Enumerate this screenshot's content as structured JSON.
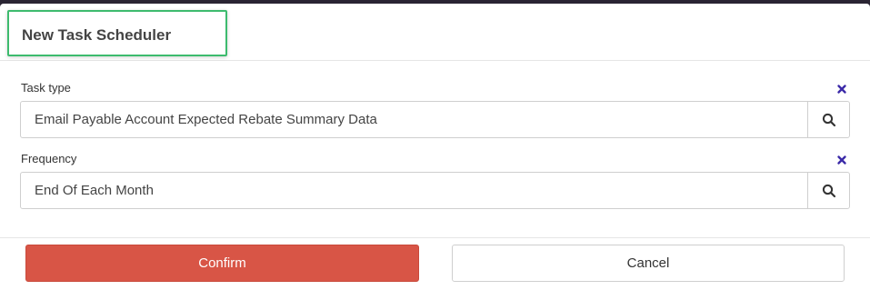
{
  "dialog": {
    "title": "New Task Scheduler"
  },
  "fields": {
    "task_type": {
      "label": "Task type",
      "value": "Email Payable Account Expected Rebate Summary Data",
      "clear_icon": "close-x-icon",
      "search_icon": "search-icon"
    },
    "frequency": {
      "label": "Frequency",
      "value": "End Of Each Month",
      "clear_icon": "close-x-icon",
      "search_icon": "search-icon"
    }
  },
  "actions": {
    "confirm_label": "Confirm",
    "cancel_label": "Cancel"
  },
  "colors": {
    "confirm_bg": "#d85546",
    "title_highlight": "#3dbb6e",
    "clear_icon": "#3b2aa8"
  }
}
